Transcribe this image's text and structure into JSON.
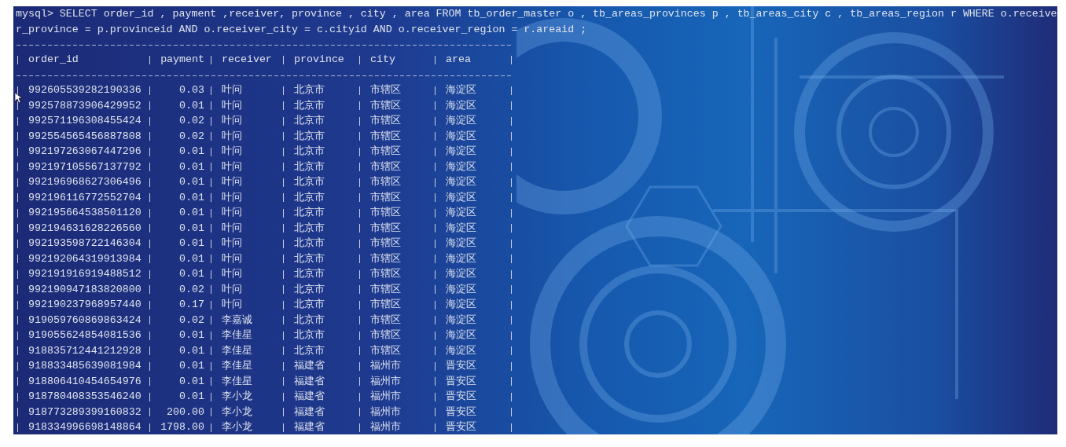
{
  "terminal": {
    "command_lines": [
      "mysql> SELECT order_id , payment ,receiver, province , city , area FROM tb_order_master o , tb_areas_provinces p , tb_areas_city c , tb_areas_region r WHERE o.receive",
      "r_province = p.provinceid AND o.receiver_city = c.cityid AND o.receiver_region = r.areaid ;"
    ],
    "table": {
      "columns": [
        "order_id",
        "payment",
        "receiver",
        "province",
        "city",
        "area"
      ],
      "rows": [
        [
          "992605539282190336",
          "0.03",
          "叶问",
          "北京市",
          "市辖区",
          "海淀区"
        ],
        [
          "992578873906429952",
          "0.01",
          "叶问",
          "北京市",
          "市辖区",
          "海淀区"
        ],
        [
          "992571196308455424",
          "0.02",
          "叶问",
          "北京市",
          "市辖区",
          "海淀区"
        ],
        [
          "992554565456887808",
          "0.02",
          "叶问",
          "北京市",
          "市辖区",
          "海淀区"
        ],
        [
          "992197263067447296",
          "0.01",
          "叶问",
          "北京市",
          "市辖区",
          "海淀区"
        ],
        [
          "992197105567137792",
          "0.01",
          "叶问",
          "北京市",
          "市辖区",
          "海淀区"
        ],
        [
          "992196968627306496",
          "0.01",
          "叶问",
          "北京市",
          "市辖区",
          "海淀区"
        ],
        [
          "992196116772552704",
          "0.01",
          "叶问",
          "北京市",
          "市辖区",
          "海淀区"
        ],
        [
          "992195664538501120",
          "0.01",
          "叶问",
          "北京市",
          "市辖区",
          "海淀区"
        ],
        [
          "992194631628226560",
          "0.01",
          "叶问",
          "北京市",
          "市辖区",
          "海淀区"
        ],
        [
          "992193598722146304",
          "0.01",
          "叶问",
          "北京市",
          "市辖区",
          "海淀区"
        ],
        [
          "992192064319913984",
          "0.01",
          "叶问",
          "北京市",
          "市辖区",
          "海淀区"
        ],
        [
          "992191916919488512",
          "0.01",
          "叶问",
          "北京市",
          "市辖区",
          "海淀区"
        ],
        [
          "992190947183820800",
          "0.02",
          "叶问",
          "北京市",
          "市辖区",
          "海淀区"
        ],
        [
          "992190237968957440",
          "0.17",
          "叶问",
          "北京市",
          "市辖区",
          "海淀区"
        ],
        [
          "919059760869863424",
          "0.02",
          "李嘉诚",
          "北京市",
          "市辖区",
          "海淀区"
        ],
        [
          "919055624854081536",
          "0.01",
          "李佳星",
          "北京市",
          "市辖区",
          "海淀区"
        ],
        [
          "918835712441212928",
          "0.01",
          "李佳星",
          "北京市",
          "市辖区",
          "海淀区"
        ],
        [
          "918833485639081984",
          "0.01",
          "李佳星",
          "福建省",
          "福州市",
          "晋安区"
        ],
        [
          "918806410454654976",
          "0.01",
          "李佳星",
          "福建省",
          "福州市",
          "晋安区"
        ],
        [
          "918780408353546240",
          "0.01",
          "李小龙",
          "福建省",
          "福州市",
          "晋安区"
        ],
        [
          "918773289399160832",
          "200.00",
          "李小龙",
          "福建省",
          "福州市",
          "晋安区"
        ],
        [
          "918334996698148864",
          "1798.00",
          "李小龙",
          "福建省",
          "福州市",
          "晋安区"
        ]
      ]
    }
  }
}
